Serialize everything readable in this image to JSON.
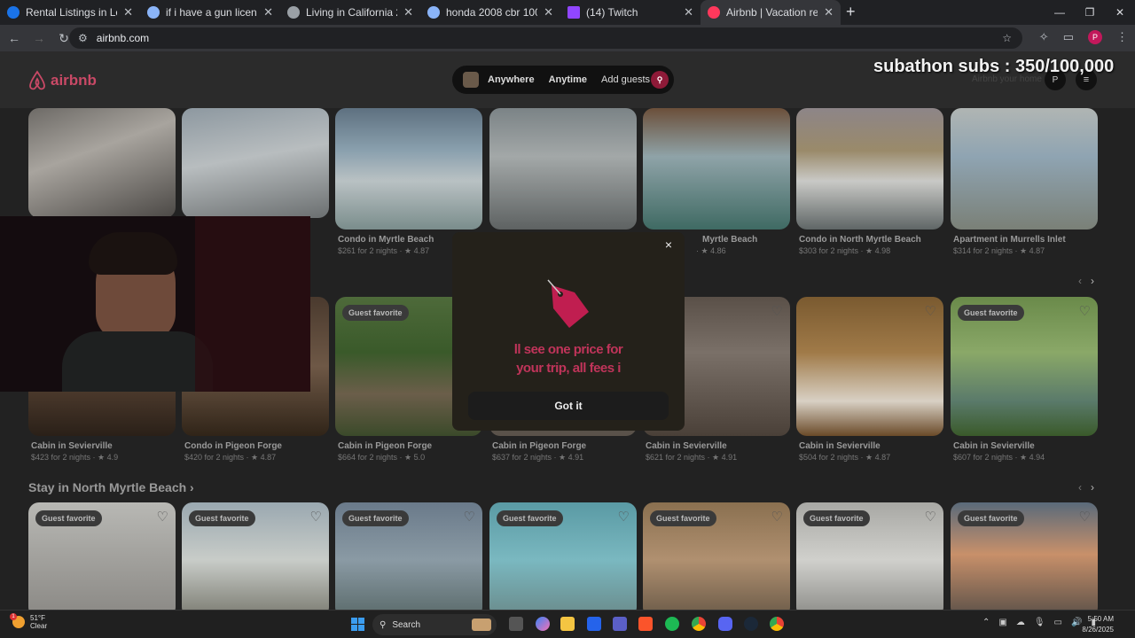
{
  "browser": {
    "tabs": [
      {
        "title": "Rental Listings in Los Angeles C",
        "color": "#1a73e8"
      },
      {
        "title": "if i have a gun license in virginia",
        "color": "#8ab4f8"
      },
      {
        "title": "Living in California 2025",
        "color": "#9aa0a6"
      },
      {
        "title": "honda 2008 cbr 1000 rr - Goog",
        "color": "#8ab4f8"
      },
      {
        "title": "(14) Twitch",
        "color": "#9146ff"
      },
      {
        "title": "Airbnb | Vacation rentals, cabin",
        "color": "#ff385c"
      }
    ],
    "url": "airbnb.com",
    "profile_initial": "P"
  },
  "header": {
    "logo_text": "airbnb",
    "search": {
      "anywhere": "Anywhere",
      "anytime": "Anytime",
      "guests": "Add guests"
    },
    "host_link": "Airbnb your home",
    "user_initial": "P",
    "overlay": "subathon subs : 350/100,000"
  },
  "row1": [
    {
      "title": "",
      "price": ""
    },
    {
      "title": "",
      "price": ""
    },
    {
      "title": "Condo in Myrtle Beach",
      "price": "$261 for 2 nights · ★ 4.87"
    },
    {
      "title": "",
      "price": ""
    },
    {
      "title": "Myrtle Beach",
      "price": "· ★ 4.86"
    },
    {
      "title": "Condo in North Myrtle Beach",
      "price": "$303 for 2 nights · ★ 4.98"
    },
    {
      "title": "Apartment in Murrells Inlet",
      "price": "$314 for 2 nights · ★ 4.87"
    }
  ],
  "row2": [
    {
      "title": "Cabin in Sevierville",
      "price": "$423 for 2 nights · ★ 4.9",
      "badge": ""
    },
    {
      "title": "Condo in Pigeon Forge",
      "price": "$420 for 2 nights · ★ 4.87",
      "badge": ""
    },
    {
      "title": "Cabin in Pigeon Forge",
      "price": "$664 for 2 nights · ★ 5.0",
      "badge": "Guest favorite"
    },
    {
      "title": "Cabin in Pigeon Forge",
      "price": "$637 for 2 nights · ★ 4.91",
      "badge": ""
    },
    {
      "title": "Cabin in Sevierville",
      "price": "$621 for 2 nights · ★ 4.91",
      "badge": ""
    },
    {
      "title": "Cabin in Sevierville",
      "price": "$504 for 2 nights · ★ 4.87",
      "badge": ""
    },
    {
      "title": "Cabin in Sevierville",
      "price": "$607 for 2 nights · ★ 4.94",
      "badge": "Guest favorite"
    }
  ],
  "section3": {
    "title": "Stay in North Myrtle Beach ›"
  },
  "row3_badge": "Guest favorite",
  "modal": {
    "line1": "ll see one price for",
    "line2": "your trip, all fees i",
    "button": "Got it",
    "close": "×"
  },
  "taskbar": {
    "temp": "51°F",
    "condition": "Clear",
    "search_placeholder": "Search",
    "time": "5:50 AM",
    "date": "8/26/2025"
  }
}
